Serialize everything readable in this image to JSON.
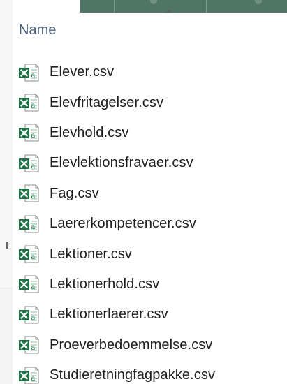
{
  "header": {
    "name_column": "Name",
    "sort_icon": "chevron-up-icon"
  },
  "files": [
    {
      "name": "Elever.csv",
      "icon": "excel-csv-file-icon"
    },
    {
      "name": "Elevfritagelser.csv",
      "icon": "excel-csv-file-icon"
    },
    {
      "name": "Elevhold.csv",
      "icon": "excel-csv-file-icon"
    },
    {
      "name": "Elevlektionsfravaer.csv",
      "icon": "excel-csv-file-icon"
    },
    {
      "name": "Fag.csv",
      "icon": "excel-csv-file-icon"
    },
    {
      "name": "Laererkompetencer.csv",
      "icon": "excel-csv-file-icon"
    },
    {
      "name": "Lektioner.csv",
      "icon": "excel-csv-file-icon"
    },
    {
      "name": "Lektionerhold.csv",
      "icon": "excel-csv-file-icon"
    },
    {
      "name": "Lektionerlaerer.csv",
      "icon": "excel-csv-file-icon"
    },
    {
      "name": "Proeverbedoemmelse.csv",
      "icon": "excel-csv-file-icon"
    },
    {
      "name": "Studieretningfagpakke.csv",
      "icon": "excel-csv-file-icon"
    }
  ],
  "colors": {
    "excel_green": "#1e7145",
    "header_text": "#4c607a",
    "file_text": "#1e1e1e",
    "top_band": "#4f7566"
  }
}
